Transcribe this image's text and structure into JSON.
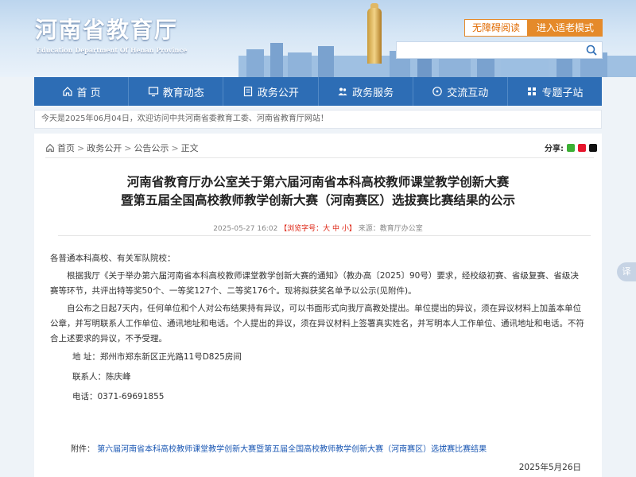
{
  "header": {
    "title": "河南省教育厅",
    "subtitle": "Education Department Of Henan Province",
    "accessibility_label": "无障碍阅读",
    "elder_mode_label": "进入适老模式",
    "search_placeholder": ""
  },
  "nav": {
    "items": [
      {
        "label": "首 页",
        "icon": "home-icon"
      },
      {
        "label": "教育动态",
        "icon": "monitor-icon"
      },
      {
        "label": "政务公开",
        "icon": "document-icon"
      },
      {
        "label": "政务服务",
        "icon": "people-icon"
      },
      {
        "label": "交流互动",
        "icon": "chat-icon"
      },
      {
        "label": "专题子站",
        "icon": "grid-icon"
      }
    ]
  },
  "notice": "今天是2025年06月04日，欢迎访问中共河南省委教育工委、河南省教育厅网站！",
  "breadcrumb": {
    "home": "首页",
    "level1": "政务公开",
    "level2": "公告公示",
    "current": "正文"
  },
  "share_label": "分享:",
  "article": {
    "title_line1": "河南省教育厅办公室关于第六届河南省本科高校教师课堂教学创新大赛",
    "title_line2": "暨第五届全国高校教师教学创新大赛（河南赛区）选拔赛比赛结果的公示",
    "date": "2025-05-27 16:02",
    "font_size_label": "【浏览字号：大 中 小】",
    "source": "来源：教育厅办公室",
    "salutation": "各普通本科高校、有关军队院校：",
    "para1": "根据我厅《关于举办第六届河南省本科高校教师课堂教学创新大赛的通知》（教办高〔2025〕90号）要求，经校级初赛、省级复赛、省级决赛等环节，共评出特等奖50个、一等奖127个、二等奖176个。现将拟获奖名单予以公示(见附件)。",
    "para2": "自公布之日起7天内，任何单位和个人对公布结果持有异议，可以书面形式向我厅高教处提出。单位提出的异议，须在异议材料上加盖本单位公章，并写明联系人工作单位、通讯地址和电话。个人提出的异议，须在异议材料上签署真实姓名，并写明本人工作单位、通讯地址和电话。不符合上述要求的异议，不予受理。",
    "address": "地 址：郑州市郑东新区正光路11号D825房间",
    "contact": "联系人：陈庆峰",
    "phone": "电话：0371-69691855",
    "attachment_label": "附件：",
    "attachment_link": "第六届河南省本科高校教师课堂教学创新大赛暨第五届全国高校教师教学创新大赛（河南赛区）选拔赛比赛结果",
    "sign_date": "2025年5月26日"
  },
  "translate_label": "译"
}
